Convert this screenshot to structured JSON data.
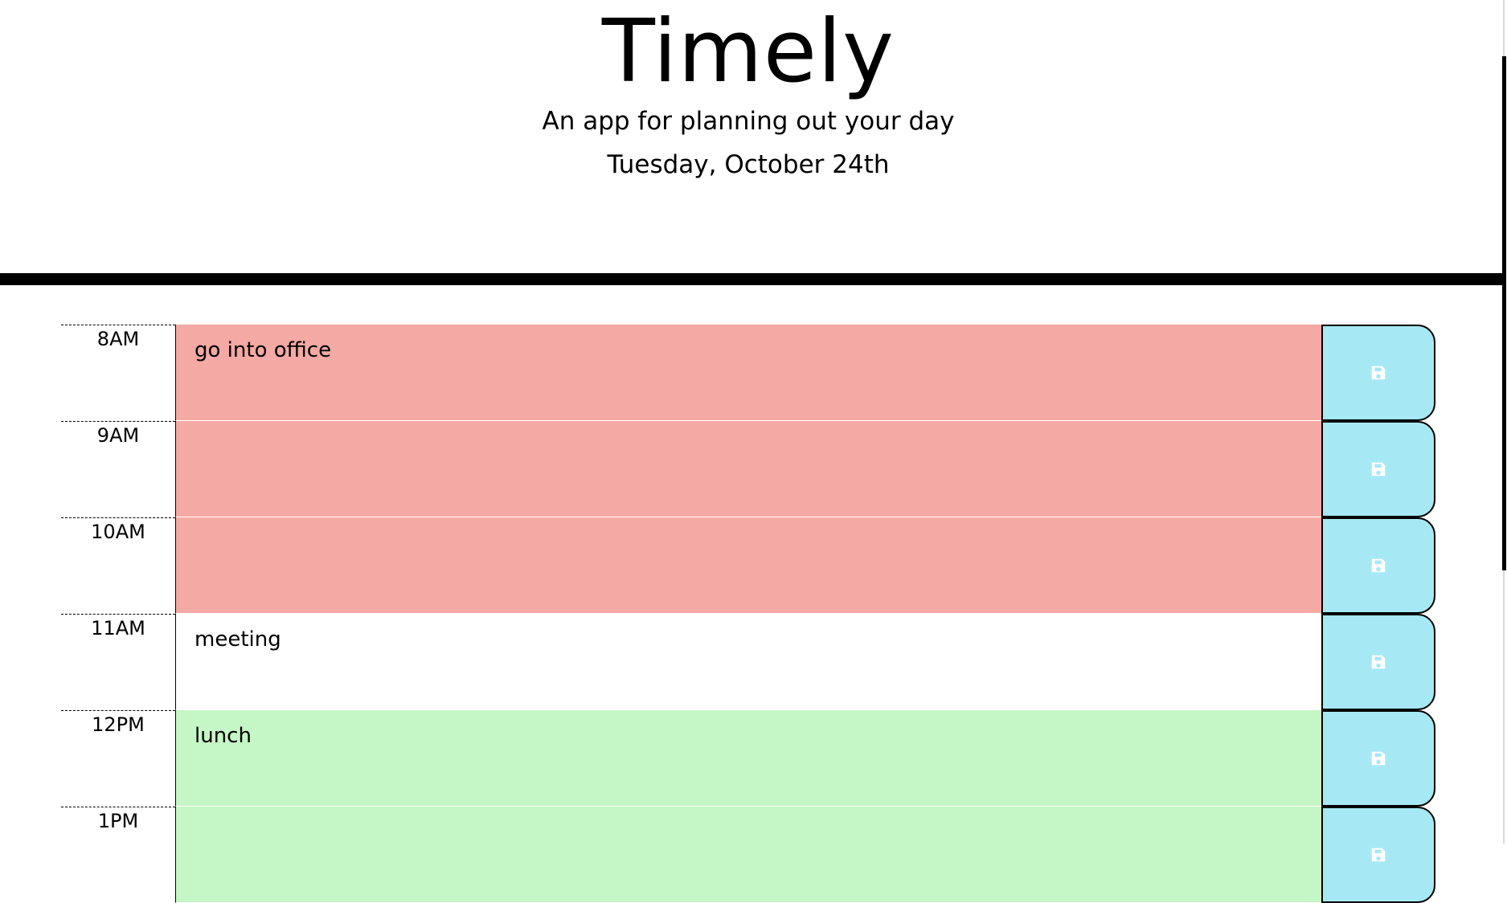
{
  "header": {
    "title": "Timely",
    "tagline": "An app for planning out your day",
    "date": "Tuesday, October 24th"
  },
  "schedule": [
    {
      "hour": "8AM",
      "task": "go into office",
      "state": "past"
    },
    {
      "hour": "9AM",
      "task": "",
      "state": "past"
    },
    {
      "hour": "10AM",
      "task": "",
      "state": "past"
    },
    {
      "hour": "11AM",
      "task": "meeting",
      "state": "present"
    },
    {
      "hour": "12PM",
      "task": "lunch",
      "state": "future"
    },
    {
      "hour": "1PM",
      "task": "",
      "state": "future"
    }
  ],
  "icons": {
    "save": "floppy-disk-icon"
  },
  "colors": {
    "past": "#f4a9a4",
    "present": "#ffffff",
    "future": "#c5f6c5",
    "save_button": "#a6e9f5"
  }
}
